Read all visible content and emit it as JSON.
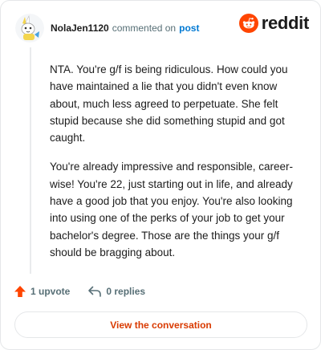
{
  "comment": {
    "username": "NolaJen1120",
    "action_text": "commented on",
    "post_link": "post",
    "paragraphs": [
      "NTA. You're g/f is being ridiculous. How could you have maintained a lie that you didn't even know about, much less agreed to perpetuate. She felt stupid because she did something stupid and got caught.",
      "You're already impressive and responsible, career-wise! You're 22, just starting out in life, and already have a good job that you enjoy. You're also looking into using one of the perks of your job to get your bachelor's degree. Those are the things your g/f should be bragging about."
    ]
  },
  "brand": {
    "name": "reddit",
    "icon": "reddit-alien-icon",
    "color": "#ff4500"
  },
  "actions": {
    "upvotes": "1 upvote",
    "replies": "0 replies",
    "upvote_icon": "upvote-arrow-icon",
    "reply_icon": "reply-arrow-icon",
    "upvote_color": "#ff4500"
  },
  "cta": {
    "label": "View the conversation",
    "color": "#d93a00"
  }
}
